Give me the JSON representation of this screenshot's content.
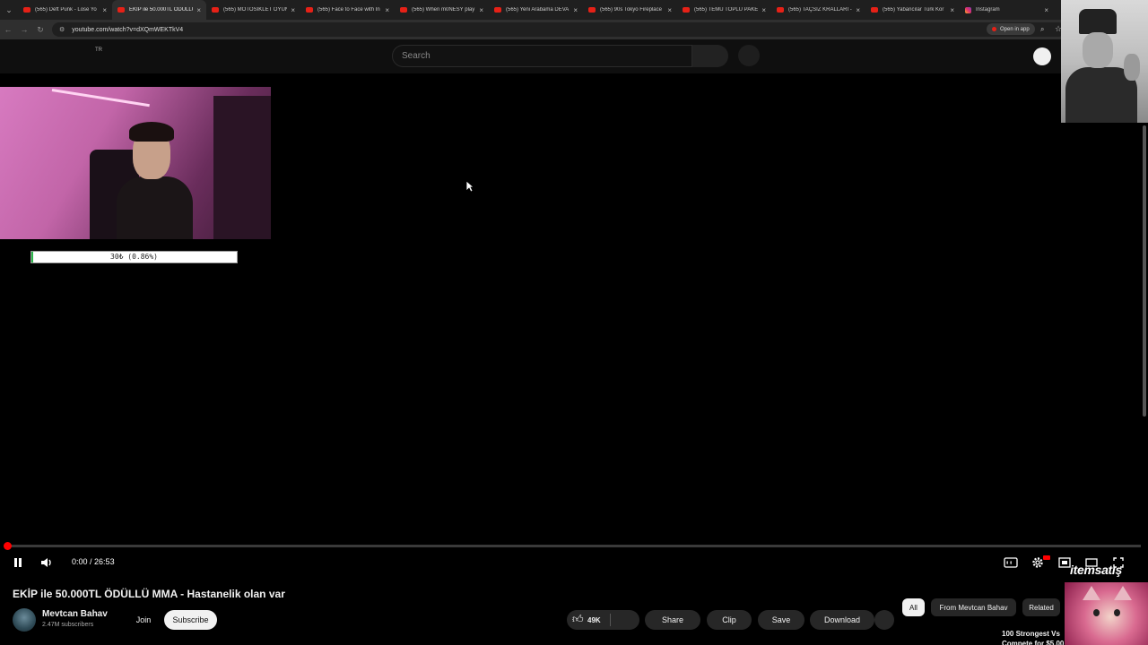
{
  "browser": {
    "tabs": [
      {
        "label": "(565) Deft Punk - Lose Yo",
        "active": false,
        "icon": "youtube-icon"
      },
      {
        "label": "EKİP ile 50.000TL ÖDÜLLÜ",
        "active": true,
        "icon": "youtube-icon"
      },
      {
        "label": "(565) MOTOSİKLET OYUN",
        "active": false,
        "icon": "youtube-icon"
      },
      {
        "label": "(565) Face to Face with In",
        "active": false,
        "icon": "youtube-icon"
      },
      {
        "label": "(565) When m0NESY play",
        "active": false,
        "icon": "youtube-icon"
      },
      {
        "label": "(565) Yeni Arabama DEVA",
        "active": false,
        "icon": "youtube-icon"
      },
      {
        "label": "(565) 90s Tokyo Fireplace",
        "active": false,
        "icon": "youtube-icon"
      },
      {
        "label": "(565) TEMU TOPLU PAKET",
        "active": false,
        "icon": "youtube-icon"
      },
      {
        "label": "(565) TAÇSIZ KRALLARI -",
        "active": false,
        "icon": "youtube-icon"
      },
      {
        "label": "(565) Yabancılar Türk Kor",
        "active": false,
        "icon": "youtube-icon"
      },
      {
        "label": "Instagram",
        "active": false,
        "icon": "instagram-icon"
      }
    ],
    "url": "youtube.com/watch?v=dXQmWEKTkV4",
    "open_in_app": "Open in app"
  },
  "masthead": {
    "country_code": "TR",
    "search_placeholder": "Search"
  },
  "overlay": {
    "donation_text": "30₺ (0.86%)",
    "donation_progress": 0.0086
  },
  "player": {
    "current_time": "0:00",
    "duration": "26:53",
    "watermark": "itemsatış",
    "progress": 0.003
  },
  "video": {
    "title": "EKİP ile 50.000TL ÖDÜLLÜ MMA - Hastanelik olan var",
    "channel": "Mevtcan Bahav",
    "subscribers": "2.47M subscribers",
    "join_label": "Join",
    "subscribe_label": "Subscribe",
    "likes": "49K",
    "share_label": "Share",
    "clip_label": "Clip",
    "save_label": "Save",
    "download_label": "Download"
  },
  "chips": [
    {
      "label": "All",
      "active": true
    },
    {
      "label": "From Mevtcan Bahav",
      "active": false
    },
    {
      "label": "Related",
      "active": false
    }
  ],
  "related": {
    "first_title": "100 Strongest Vs Compete for $5,00"
  },
  "colors": {
    "youtube_red": "#ff0000",
    "bg": "#0f0f0f",
    "progress_green": "#29b84a"
  }
}
